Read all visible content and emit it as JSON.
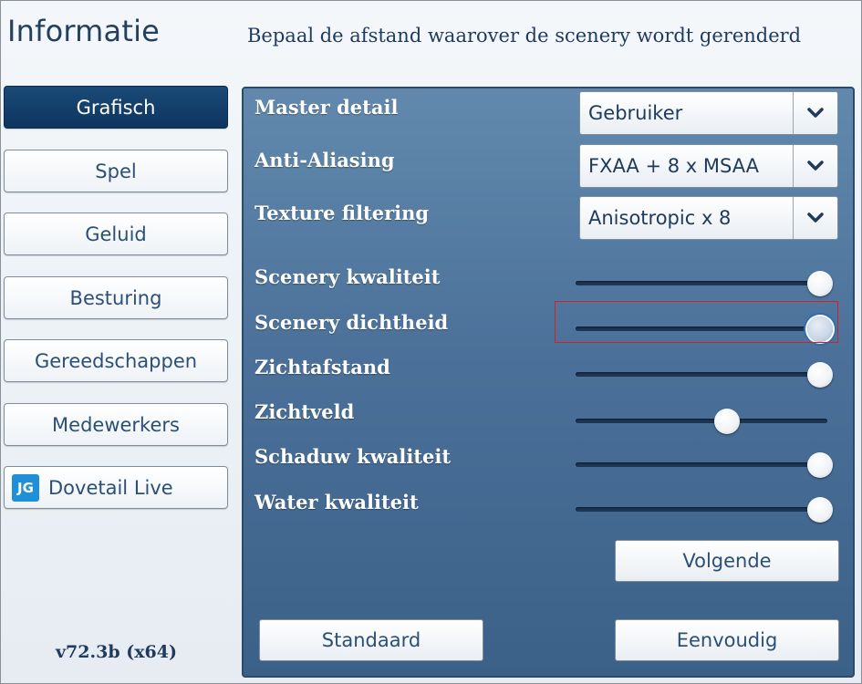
{
  "header": {
    "title": "Informatie",
    "subtitle": "Bepaal de afstand waarover de scenery wordt gerenderd"
  },
  "sidebar": {
    "items": [
      {
        "label": "Grafisch",
        "active": true
      },
      {
        "label": "Spel",
        "active": false
      },
      {
        "label": "Geluid",
        "active": false
      },
      {
        "label": "Besturing",
        "active": false
      },
      {
        "label": "Gereedschappen",
        "active": false
      },
      {
        "label": "Medewerkers",
        "active": false
      },
      {
        "label": "Dovetail Live",
        "active": false,
        "icon": "dovetail-live-logo",
        "icon_text": "JG"
      }
    ],
    "version": "v72.3b (x64)"
  },
  "settings": {
    "dropdowns": [
      {
        "label": "Master detail",
        "value": "Gebruiker"
      },
      {
        "label": "Anti-Aliasing",
        "value": "FXAA + 8 x MSAA"
      },
      {
        "label": "Texture filtering",
        "value": "Anisotropic x 8"
      }
    ],
    "sliders": [
      {
        "label": "Scenery kwaliteit",
        "value": 1.0
      },
      {
        "label": "Scenery dichtheid",
        "value": 1.0,
        "focused": true
      },
      {
        "label": "Zichtafstand",
        "value": 1.0
      },
      {
        "label": "Zichtveld",
        "value": 0.62
      },
      {
        "label": "Schaduw kwaliteit",
        "value": 1.0
      },
      {
        "label": "Water kwaliteit",
        "value": 1.0
      }
    ]
  },
  "buttons": {
    "next": "Volgende",
    "default": "Standaard",
    "simple": "Eenvoudig"
  },
  "colors": {
    "panel": "#4b719a",
    "active_nav": "#0e3560",
    "highlight": "#d42020"
  }
}
